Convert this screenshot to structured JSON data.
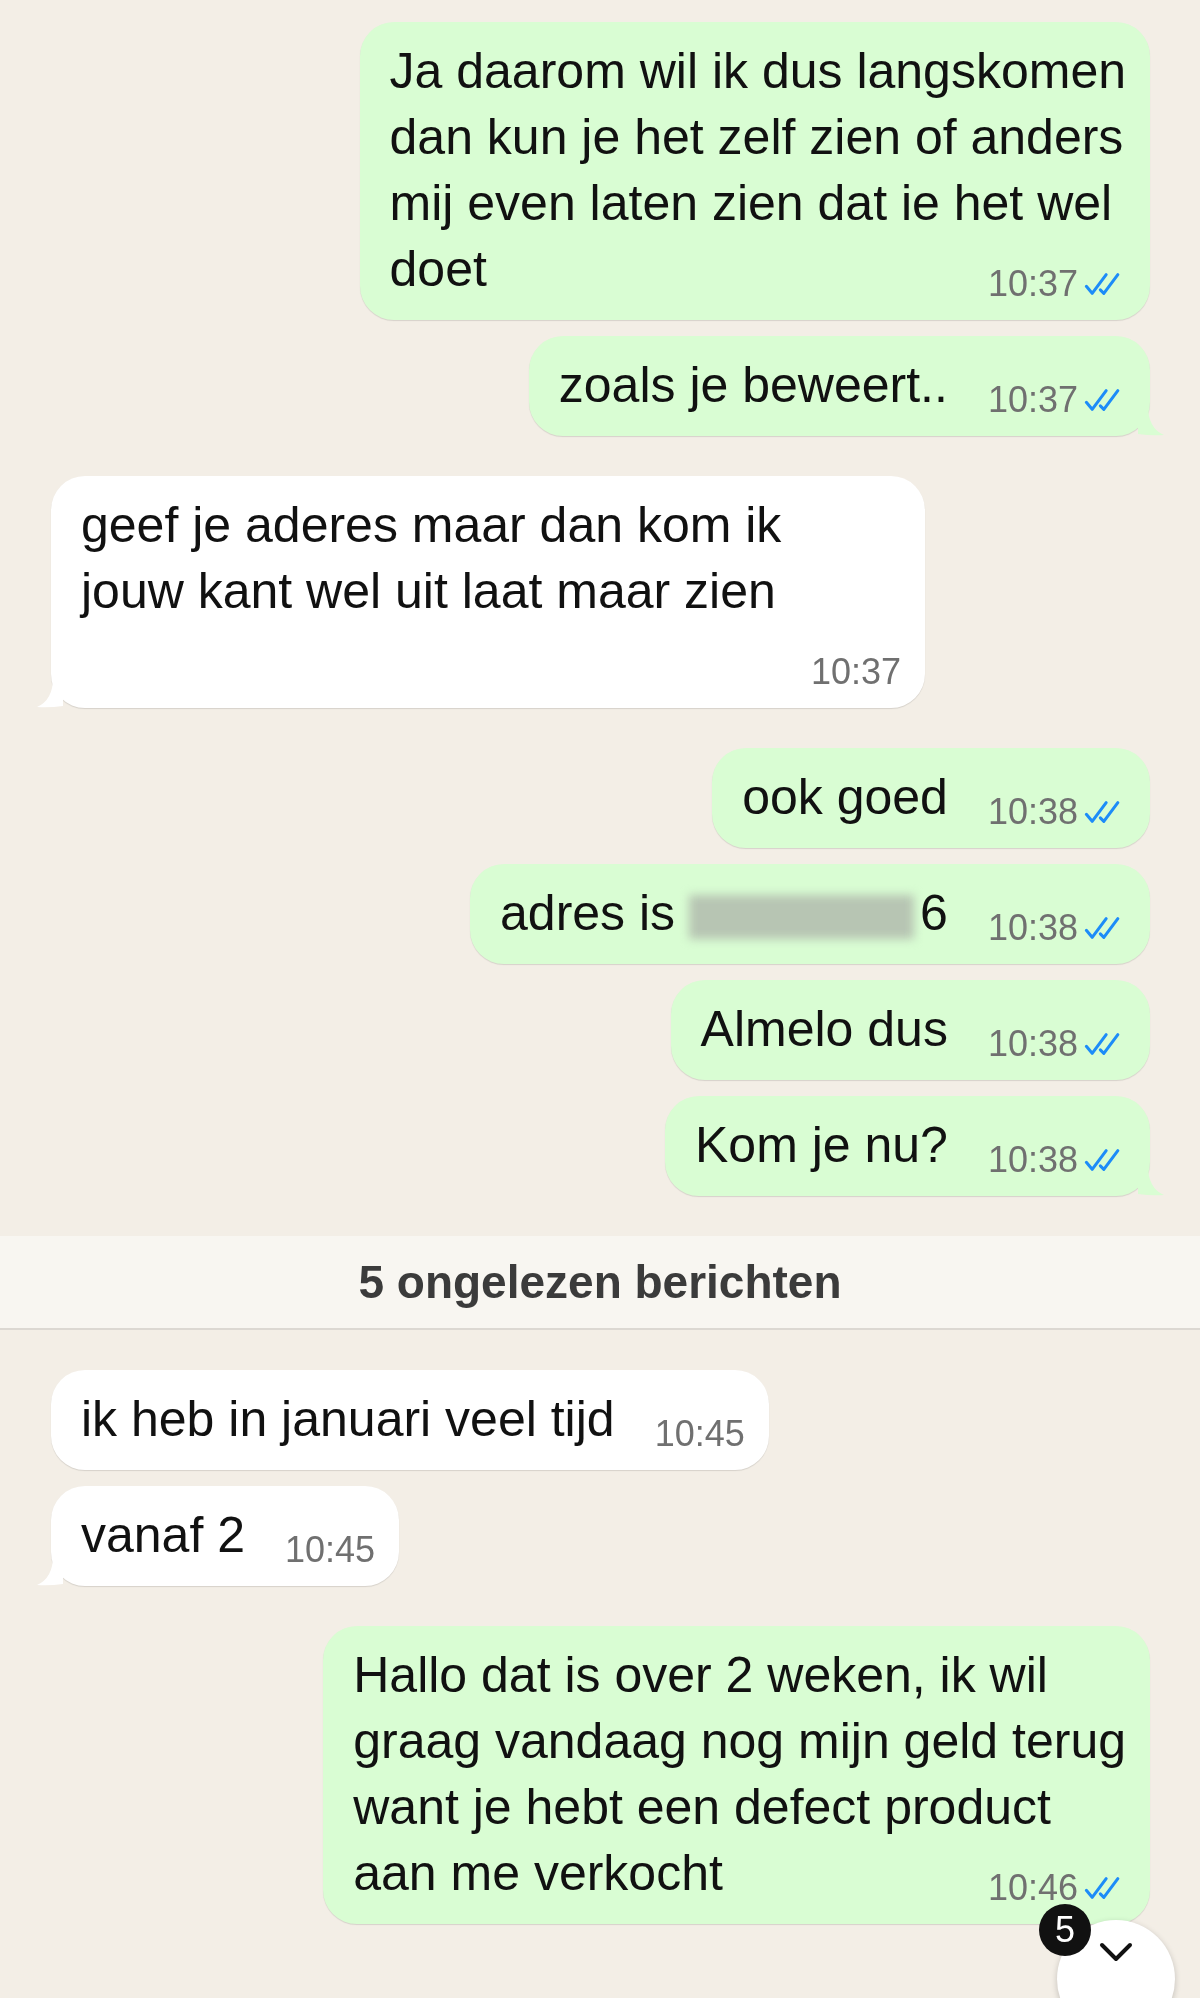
{
  "messages": [
    {
      "outgoing": true,
      "lines": [
        "Ja daarom wil ik dus langskomen",
        "dan kun je het zelf zien of anders",
        "mij even laten zien dat ie het wel",
        "doet"
      ],
      "time": "10:37",
      "read": true,
      "tail": false
    },
    {
      "outgoing": true,
      "lines": [
        "zoals je beweert.."
      ],
      "time": "10:37",
      "read": true,
      "tail": true
    },
    {
      "outgoing": false,
      "lines": [
        "geef je aderes maar dan kom ik",
        "jouw kant wel uit laat maar zien"
      ],
      "time": "10:37",
      "tail": true
    },
    {
      "outgoing": true,
      "lines": [
        "ook goed"
      ],
      "time": "10:38",
      "read": true,
      "tail": false
    },
    {
      "outgoing": true,
      "lines": [
        "adres is"
      ],
      "redacted": true,
      "after": "6",
      "time": "10:38",
      "read": true,
      "tail": false
    },
    {
      "outgoing": true,
      "lines": [
        "Almelo dus"
      ],
      "time": "10:38",
      "read": true,
      "tail": false
    },
    {
      "outgoing": true,
      "lines": [
        "Kom je nu?"
      ],
      "time": "10:38",
      "read": true,
      "tail": true
    },
    {
      "kind": "divider",
      "text": "5 ongelezen berichten"
    },
    {
      "outgoing": false,
      "lines": [
        "ik heb in januari veel tijd"
      ],
      "time": "10:45",
      "tail": false
    },
    {
      "outgoing": false,
      "lines": [
        "vanaf 2"
      ],
      "time": "10:45",
      "tail": true
    },
    {
      "outgoing": true,
      "lines": [
        "Hallo dat is over 2 weken, ik wil",
        "graag vandaag nog mijn geld terug",
        "want je hebt een defect product",
        "aan me verkocht"
      ],
      "time": "10:46",
      "read": true,
      "tail": false
    }
  ],
  "scroll_button": {
    "badge": "5"
  }
}
